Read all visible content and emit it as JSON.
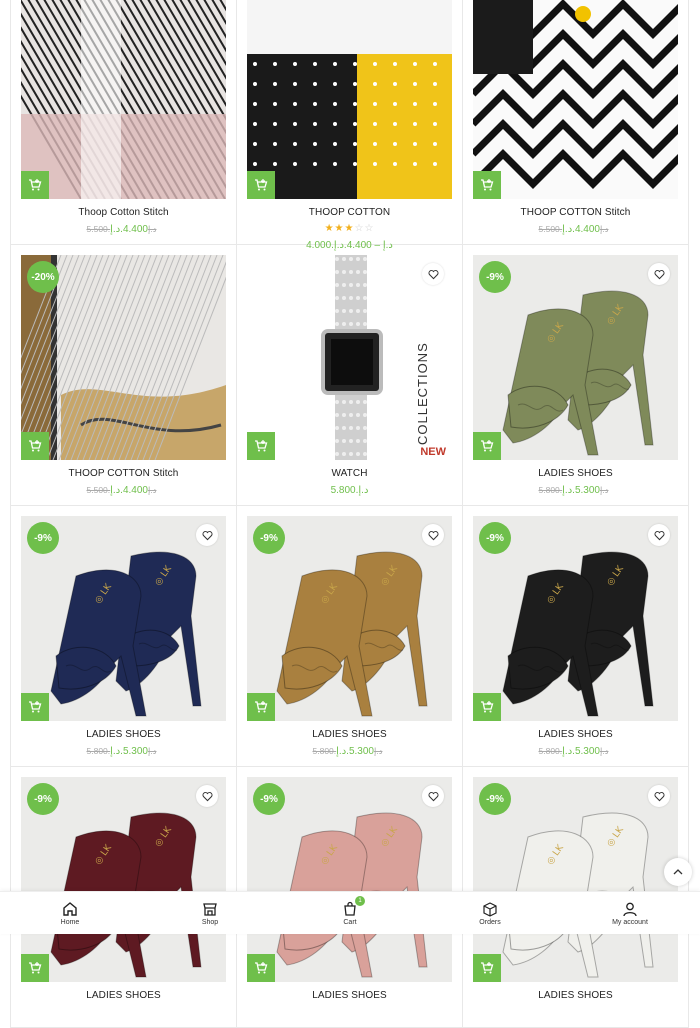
{
  "colors": {
    "accent": "#6fbf4b",
    "star": "#f2b01e"
  },
  "products": [
    {
      "title": "Thoop Cotton Stitch",
      "old_price": "5.500.د.إ",
      "price": "4.400.د.إ",
      "art": "fabric-pink"
    },
    {
      "title": "THOOP COTTON",
      "price_range": "4.000.د.إ – 4.400.د.إ",
      "rating": 3,
      "art": "fabric-yellow"
    },
    {
      "title": "THOOP COTTON Stitch",
      "old_price": "5.500.د.إ",
      "price": "4.400.د.إ",
      "art": "fabric-zigzag"
    },
    {
      "title": "THOOP COTTON Stitch",
      "badge": "-20%",
      "old_price": "5.500.د.إ",
      "price": "4.400.د.إ",
      "art": "fabric-camo"
    },
    {
      "title": "WATCH",
      "price": "5.800.د.إ",
      "art": "watch",
      "watch_text": "COLLECTIONS",
      "watch_new": "NEW"
    },
    {
      "title": "LADIES SHOES",
      "badge": "-9%",
      "old_price": "5.800.د.إ",
      "price": "5.300.د.إ",
      "art": "shoe",
      "shoe_color": "#7f8a5a"
    },
    {
      "title": "LADIES SHOES",
      "badge": "-9%",
      "old_price": "5.800.د.إ",
      "price": "5.300.د.إ",
      "art": "shoe",
      "shoe_color": "#1f2a55"
    },
    {
      "title": "LADIES SHOES",
      "badge": "-9%",
      "old_price": "5.800.د.إ",
      "price": "5.300.د.إ",
      "art": "shoe",
      "shoe_color": "#a9803f"
    },
    {
      "title": "LADIES SHOES",
      "badge": "-9%",
      "old_price": "5.800.د.إ",
      "price": "5.300.د.إ",
      "art": "shoe",
      "shoe_color": "#1d1d1d"
    },
    {
      "title": "LADIES SHOES",
      "badge": "-9%",
      "art": "shoe",
      "shoe_color": "#5e1a22"
    },
    {
      "title": "LADIES SHOES",
      "badge": "-9%",
      "art": "shoe",
      "shoe_color": "#d9a19a"
    },
    {
      "title": "LADIES SHOES",
      "badge": "-9%",
      "art": "shoe",
      "shoe_color": "#f0f0ec"
    }
  ],
  "nav": {
    "items": [
      {
        "label": "Home",
        "icon": "home-icon"
      },
      {
        "label": "Shop",
        "icon": "shop-icon"
      },
      {
        "label": "Cart",
        "icon": "cart-icon",
        "count": "1"
      },
      {
        "label": "Orders",
        "icon": "orders-icon"
      },
      {
        "label": "My account",
        "icon": "user-icon"
      }
    ]
  }
}
